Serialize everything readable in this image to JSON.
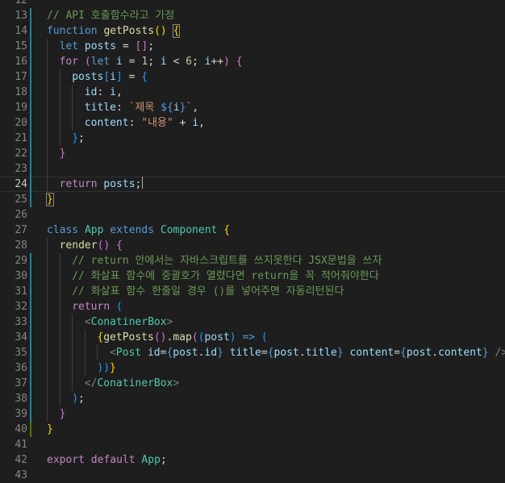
{
  "editor": {
    "colors": {
      "background": "#1e1e1e",
      "line_number": "#858585",
      "active_line_number": "#c6c6c6",
      "modified_gutter": "#1b81a8",
      "added_gutter": "#487e02",
      "indent_guide": "#404040"
    },
    "first_line_number": 12,
    "active_line": 24,
    "lines": [
      {
        "n": 12,
        "indent": 0,
        "tokens": []
      },
      {
        "n": 13,
        "indent": 0,
        "gutter": "modified",
        "tokens": [
          {
            "t": "// API 호출함수라고 가정",
            "c": "#6a9955"
          }
        ]
      },
      {
        "n": 14,
        "indent": 0,
        "gutter": "modified",
        "tokens": [
          {
            "t": "function",
            "c": "#569cd6"
          },
          {
            "t": " ",
            "c": "#d4d4d4"
          },
          {
            "t": "getPosts",
            "c": "#dcdcaa"
          },
          {
            "t": "()",
            "c": "#ffd700"
          },
          {
            "t": " ",
            "c": "#d4d4d4"
          },
          {
            "t": "{",
            "c": "#ffd700",
            "box": true
          }
        ]
      },
      {
        "n": 15,
        "indent": 1,
        "gutter": "modified",
        "tokens": [
          {
            "t": "let",
            "c": "#569cd6"
          },
          {
            "t": " ",
            "c": "#d4d4d4"
          },
          {
            "t": "posts",
            "c": "#9cdcfe"
          },
          {
            "t": " = ",
            "c": "#d4d4d4"
          },
          {
            "t": "[]",
            "c": "#da70d6"
          },
          {
            "t": ";",
            "c": "#d4d4d4"
          }
        ]
      },
      {
        "n": 16,
        "indent": 1,
        "gutter": "modified",
        "tokens": [
          {
            "t": "for",
            "c": "#c586c0"
          },
          {
            "t": " ",
            "c": "#d4d4d4"
          },
          {
            "t": "(",
            "c": "#da70d6"
          },
          {
            "t": "let",
            "c": "#569cd6"
          },
          {
            "t": " ",
            "c": "#d4d4d4"
          },
          {
            "t": "i",
            "c": "#9cdcfe"
          },
          {
            "t": " = ",
            "c": "#d4d4d4"
          },
          {
            "t": "1",
            "c": "#b5cea8"
          },
          {
            "t": "; ",
            "c": "#d4d4d4"
          },
          {
            "t": "i",
            "c": "#9cdcfe"
          },
          {
            "t": " < ",
            "c": "#d4d4d4"
          },
          {
            "t": "6",
            "c": "#b5cea8"
          },
          {
            "t": "; ",
            "c": "#d4d4d4"
          },
          {
            "t": "i",
            "c": "#9cdcfe"
          },
          {
            "t": "++",
            "c": "#d4d4d4"
          },
          {
            "t": ")",
            "c": "#da70d6"
          },
          {
            "t": " ",
            "c": "#d4d4d4"
          },
          {
            "t": "{",
            "c": "#da70d6"
          }
        ]
      },
      {
        "n": 17,
        "indent": 2,
        "gutter": "modified",
        "tokens": [
          {
            "t": "posts",
            "c": "#9cdcfe"
          },
          {
            "t": "[",
            "c": "#179fff"
          },
          {
            "t": "i",
            "c": "#9cdcfe"
          },
          {
            "t": "]",
            "c": "#179fff"
          },
          {
            "t": " = ",
            "c": "#d4d4d4"
          },
          {
            "t": "{",
            "c": "#179fff"
          }
        ]
      },
      {
        "n": 18,
        "indent": 3,
        "gutter": "modified",
        "tokens": [
          {
            "t": "id",
            "c": "#9cdcfe"
          },
          {
            "t": ": ",
            "c": "#d4d4d4"
          },
          {
            "t": "i",
            "c": "#9cdcfe"
          },
          {
            "t": ",",
            "c": "#d4d4d4"
          }
        ]
      },
      {
        "n": 19,
        "indent": 3,
        "gutter": "modified",
        "tokens": [
          {
            "t": "title",
            "c": "#9cdcfe"
          },
          {
            "t": ": ",
            "c": "#d4d4d4"
          },
          {
            "t": "`제목 ",
            "c": "#ce9178"
          },
          {
            "t": "${",
            "c": "#569cd6"
          },
          {
            "t": "i",
            "c": "#9cdcfe"
          },
          {
            "t": "}",
            "c": "#569cd6"
          },
          {
            "t": "`",
            "c": "#ce9178"
          },
          {
            "t": ",",
            "c": "#d4d4d4"
          }
        ]
      },
      {
        "n": 20,
        "indent": 3,
        "gutter": "modified",
        "tokens": [
          {
            "t": "content",
            "c": "#9cdcfe"
          },
          {
            "t": ": ",
            "c": "#d4d4d4"
          },
          {
            "t": "\"내용\"",
            "c": "#ce9178"
          },
          {
            "t": " + ",
            "c": "#d4d4d4"
          },
          {
            "t": "i",
            "c": "#9cdcfe"
          },
          {
            "t": ",",
            "c": "#d4d4d4"
          }
        ]
      },
      {
        "n": 21,
        "indent": 2,
        "gutter": "modified",
        "tokens": [
          {
            "t": "}",
            "c": "#179fff"
          },
          {
            "t": ";",
            "c": "#d4d4d4"
          }
        ]
      },
      {
        "n": 22,
        "indent": 1,
        "gutter": "modified",
        "tokens": [
          {
            "t": "}",
            "c": "#da70d6"
          }
        ]
      },
      {
        "n": 23,
        "indent": 1,
        "gutter": "modified",
        "tokens": []
      },
      {
        "n": 24,
        "indent": 1,
        "gutter": "modified",
        "active": true,
        "caret_after": true,
        "tokens": [
          {
            "t": "return",
            "c": "#c586c0"
          },
          {
            "t": " ",
            "c": "#d4d4d4"
          },
          {
            "t": "posts",
            "c": "#9cdcfe"
          },
          {
            "t": ";",
            "c": "#d4d4d4"
          }
        ]
      },
      {
        "n": 25,
        "indent": 0,
        "gutter": "modified",
        "tokens": [
          {
            "t": "}",
            "c": "#ffd700",
            "box": true
          }
        ]
      },
      {
        "n": 26,
        "indent": 0,
        "tokens": []
      },
      {
        "n": 27,
        "indent": 0,
        "tokens": [
          {
            "t": "class",
            "c": "#569cd6"
          },
          {
            "t": " ",
            "c": "#d4d4d4"
          },
          {
            "t": "App",
            "c": "#4ec9b0"
          },
          {
            "t": " ",
            "c": "#d4d4d4"
          },
          {
            "t": "extends",
            "c": "#569cd6"
          },
          {
            "t": " ",
            "c": "#d4d4d4"
          },
          {
            "t": "Component",
            "c": "#4ec9b0"
          },
          {
            "t": " ",
            "c": "#d4d4d4"
          },
          {
            "t": "{",
            "c": "#ffd700"
          }
        ]
      },
      {
        "n": 28,
        "indent": 1,
        "tokens": [
          {
            "t": "render",
            "c": "#dcdcaa"
          },
          {
            "t": "()",
            "c": "#da70d6"
          },
          {
            "t": " ",
            "c": "#d4d4d4"
          },
          {
            "t": "{",
            "c": "#da70d6"
          }
        ]
      },
      {
        "n": 29,
        "indent": 2,
        "gutter": "modified",
        "tokens": [
          {
            "t": "// return 안에서는 자바스크립트를 쓰지못한다 JSX문법을 쓰자",
            "c": "#6a9955"
          }
        ]
      },
      {
        "n": 30,
        "indent": 2,
        "gutter": "modified",
        "tokens": [
          {
            "t": "// 화살표 함수에 중괄호가 열렸다면 return을 꼭 적어줘야한다",
            "c": "#6a9955"
          }
        ]
      },
      {
        "n": 31,
        "indent": 2,
        "gutter": "modified",
        "tokens": [
          {
            "t": "// 화살표 함수 한줄일 경우 ()를 넣어주면 자동리턴된다",
            "c": "#6a9955"
          }
        ]
      },
      {
        "n": 32,
        "indent": 2,
        "gutter": "modified",
        "tokens": [
          {
            "t": "return",
            "c": "#c586c0"
          },
          {
            "t": " ",
            "c": "#d4d4d4"
          },
          {
            "t": "(",
            "c": "#179fff"
          }
        ]
      },
      {
        "n": 33,
        "indent": 3,
        "gutter": "modified",
        "tokens": [
          {
            "t": "<",
            "c": "#808080"
          },
          {
            "t": "ConatinerBox",
            "c": "#4ec9b0"
          },
          {
            "t": ">",
            "c": "#808080"
          }
        ]
      },
      {
        "n": 34,
        "indent": 4,
        "gutter": "modified",
        "tokens": [
          {
            "t": "{",
            "c": "#ffd700"
          },
          {
            "t": "getPosts",
            "c": "#dcdcaa"
          },
          {
            "t": "()",
            "c": "#da70d6"
          },
          {
            "t": ".",
            "c": "#d4d4d4"
          },
          {
            "t": "map",
            "c": "#dcdcaa"
          },
          {
            "t": "(",
            "c": "#da70d6"
          },
          {
            "t": "(",
            "c": "#179fff"
          },
          {
            "t": "post",
            "c": "#9cdcfe"
          },
          {
            "t": ")",
            "c": "#179fff"
          },
          {
            "t": " ",
            "c": "#d4d4d4"
          },
          {
            "t": "=>",
            "c": "#569cd6"
          },
          {
            "t": " ",
            "c": "#d4d4d4"
          },
          {
            "t": "(",
            "c": "#179fff"
          }
        ]
      },
      {
        "n": 35,
        "indent": 5,
        "gutter": "modified",
        "tokens": [
          {
            "t": "<",
            "c": "#808080"
          },
          {
            "t": "Post",
            "c": "#4ec9b0"
          },
          {
            "t": " ",
            "c": "#d4d4d4"
          },
          {
            "t": "id",
            "c": "#9cdcfe"
          },
          {
            "t": "=",
            "c": "#d4d4d4"
          },
          {
            "t": "{",
            "c": "#569cd6"
          },
          {
            "t": "post",
            "c": "#9cdcfe"
          },
          {
            "t": ".",
            "c": "#d4d4d4"
          },
          {
            "t": "id",
            "c": "#9cdcfe"
          },
          {
            "t": "}",
            "c": "#569cd6"
          },
          {
            "t": " ",
            "c": "#d4d4d4"
          },
          {
            "t": "title",
            "c": "#9cdcfe"
          },
          {
            "t": "=",
            "c": "#d4d4d4"
          },
          {
            "t": "{",
            "c": "#569cd6"
          },
          {
            "t": "post",
            "c": "#9cdcfe"
          },
          {
            "t": ".",
            "c": "#d4d4d4"
          },
          {
            "t": "title",
            "c": "#9cdcfe"
          },
          {
            "t": "}",
            "c": "#569cd6"
          },
          {
            "t": " ",
            "c": "#d4d4d4"
          },
          {
            "t": "content",
            "c": "#9cdcfe"
          },
          {
            "t": "=",
            "c": "#d4d4d4"
          },
          {
            "t": "{",
            "c": "#569cd6"
          },
          {
            "t": "post",
            "c": "#9cdcfe"
          },
          {
            "t": ".",
            "c": "#d4d4d4"
          },
          {
            "t": "content",
            "c": "#9cdcfe"
          },
          {
            "t": "}",
            "c": "#569cd6"
          },
          {
            "t": " ",
            "c": "#d4d4d4"
          },
          {
            "t": "/>",
            "c": "#808080"
          }
        ]
      },
      {
        "n": 36,
        "indent": 4,
        "gutter": "modified",
        "tokens": [
          {
            "t": "))",
            "c": "#179fff"
          },
          {
            "t": "}",
            "c": "#ffd700"
          }
        ]
      },
      {
        "n": 37,
        "indent": 3,
        "gutter": "modified",
        "tokens": [
          {
            "t": "</",
            "c": "#808080"
          },
          {
            "t": "ConatinerBox",
            "c": "#4ec9b0"
          },
          {
            "t": ">",
            "c": "#808080"
          }
        ]
      },
      {
        "n": 38,
        "indent": 2,
        "gutter": "modified",
        "tokens": [
          {
            "t": ")",
            "c": "#179fff"
          },
          {
            "t": ";",
            "c": "#d4d4d4"
          }
        ]
      },
      {
        "n": 39,
        "indent": 1,
        "gutter": "modified",
        "tokens": [
          {
            "t": "}",
            "c": "#da70d6"
          }
        ]
      },
      {
        "n": 40,
        "indent": 0,
        "gutter": "added",
        "tokens": [
          {
            "t": "}",
            "c": "#ffd700"
          }
        ]
      },
      {
        "n": 41,
        "indent": 0,
        "tokens": []
      },
      {
        "n": 42,
        "indent": 0,
        "tokens": [
          {
            "t": "export",
            "c": "#c586c0"
          },
          {
            "t": " ",
            "c": "#d4d4d4"
          },
          {
            "t": "default",
            "c": "#c586c0"
          },
          {
            "t": " ",
            "c": "#d4d4d4"
          },
          {
            "t": "App",
            "c": "#4ec9b0"
          },
          {
            "t": ";",
            "c": "#d4d4d4"
          }
        ]
      },
      {
        "n": 43,
        "indent": 0,
        "tokens": []
      }
    ]
  }
}
